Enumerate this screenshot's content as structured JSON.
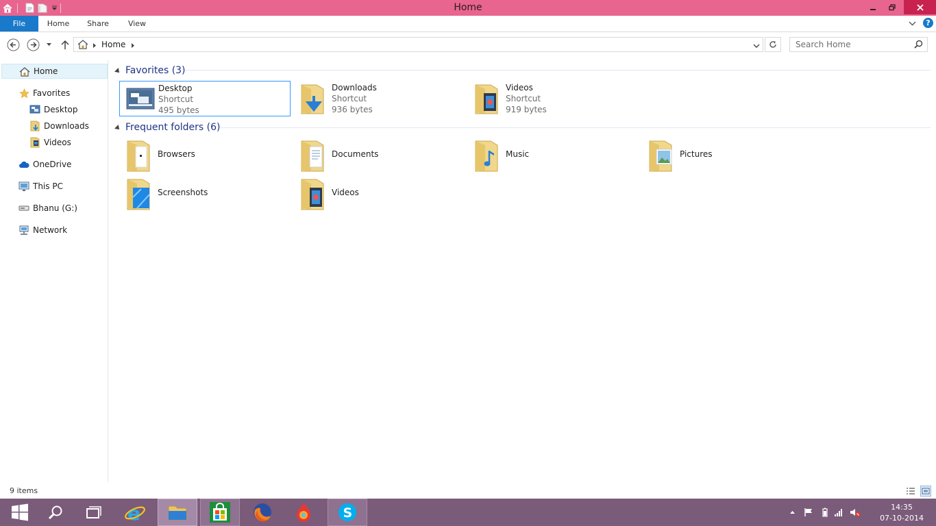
{
  "window": {
    "title": "Home"
  },
  "ribbon": {
    "tabs": [
      "File",
      "Home",
      "Share",
      "View"
    ]
  },
  "address": {
    "location": "Home"
  },
  "search": {
    "placeholder": "Search Home"
  },
  "navpane": {
    "items": [
      {
        "label": "Home",
        "icon": "home-icon"
      },
      {
        "label": "Favorites",
        "icon": "star-icon"
      },
      {
        "label": "Desktop",
        "icon": "desktop-icon"
      },
      {
        "label": "Downloads",
        "icon": "downloads-folder-icon"
      },
      {
        "label": "Videos",
        "icon": "videos-folder-icon"
      },
      {
        "label": "OneDrive",
        "icon": "cloud-icon"
      },
      {
        "label": "This PC",
        "icon": "computer-icon"
      },
      {
        "label": "Bhanu (G:)",
        "icon": "drive-icon"
      },
      {
        "label": "Network",
        "icon": "network-icon"
      }
    ]
  },
  "groups": {
    "favorites": {
      "title": "Favorites (3)",
      "items": [
        {
          "name": "Desktop",
          "type": "Shortcut",
          "size": "495 bytes"
        },
        {
          "name": "Downloads",
          "type": "Shortcut",
          "size": "936 bytes"
        },
        {
          "name": "Videos",
          "type": "Shortcut",
          "size": "919 bytes"
        }
      ]
    },
    "frequent": {
      "title": "Frequent folders (6)",
      "items": [
        {
          "name": "Browsers"
        },
        {
          "name": "Documents"
        },
        {
          "name": "Music"
        },
        {
          "name": "Pictures"
        },
        {
          "name": "Screenshots"
        },
        {
          "name": "Videos"
        }
      ]
    }
  },
  "status": {
    "items_count": "9 items"
  },
  "taskbar": {
    "apps": [
      "start",
      "search",
      "task-view",
      "internet-explorer",
      "file-explorer",
      "store",
      "firefox",
      "browser",
      "skype"
    ],
    "clock": {
      "time": "14:35",
      "date": "07-10-2014"
    }
  },
  "colors": {
    "titlebar": "#e8658f",
    "file_tab": "#1979ca",
    "taskbar": "#7b5b7a",
    "group_title": "#1e3287"
  }
}
